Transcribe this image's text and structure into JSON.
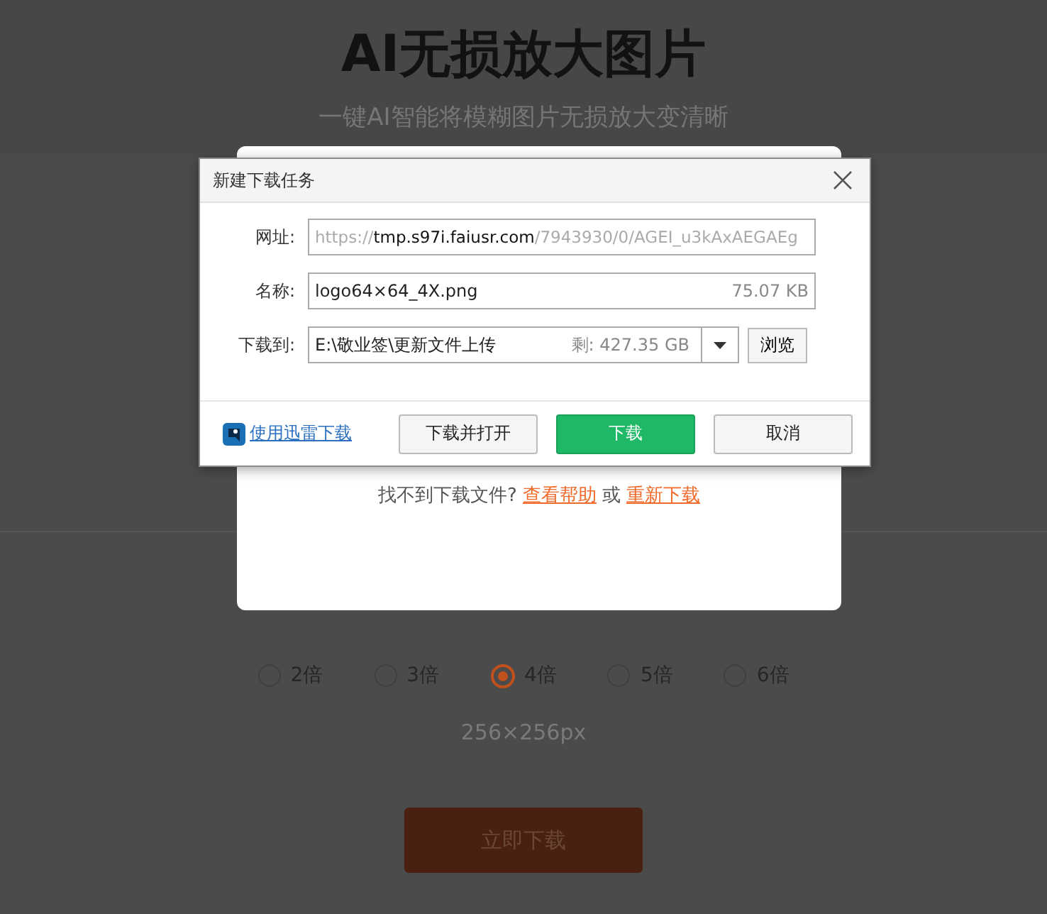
{
  "page": {
    "title": "AI无损放大图片",
    "subtitle": "一键AI智能将模糊图片无损放大变清晰",
    "scale_options": [
      {
        "label": "2倍",
        "selected": false
      },
      {
        "label": "3倍",
        "selected": false
      },
      {
        "label": "4倍",
        "selected": true
      },
      {
        "label": "5倍",
        "selected": false
      },
      {
        "label": "6倍",
        "selected": false
      }
    ],
    "size_text": "256×256px",
    "download_button": "立即下载"
  },
  "card": {
    "prompt": "找不到下载文件?",
    "help_link": "查看帮助",
    "or_text": "或",
    "redownload_link": "重新下载"
  },
  "dialog": {
    "title": "新建下载任务",
    "url_label": "网址:",
    "url_parts": [
      {
        "text": "https://",
        "emphasized": false
      },
      {
        "text": "tmp.s97i.faiusr.com",
        "emphasized": true
      },
      {
        "text": "/7943930/0/AGEI_u3kAxAEGAEg",
        "emphasized": false
      }
    ],
    "name_label": "名称:",
    "file_name": "logo64×64_4X.png",
    "file_size": "75.07 KB",
    "save_label": "下载到:",
    "save_path": "E:\\敬业签\\更新文件上传",
    "free_space": "剩: 427.35 GB",
    "browse_button": "浏览",
    "thunder_link": "使用迅雷下载",
    "buttons": [
      {
        "label": "下载并打开",
        "kind": "default"
      },
      {
        "label": "下载",
        "kind": "primary"
      },
      {
        "label": "取消",
        "kind": "default"
      }
    ]
  }
}
